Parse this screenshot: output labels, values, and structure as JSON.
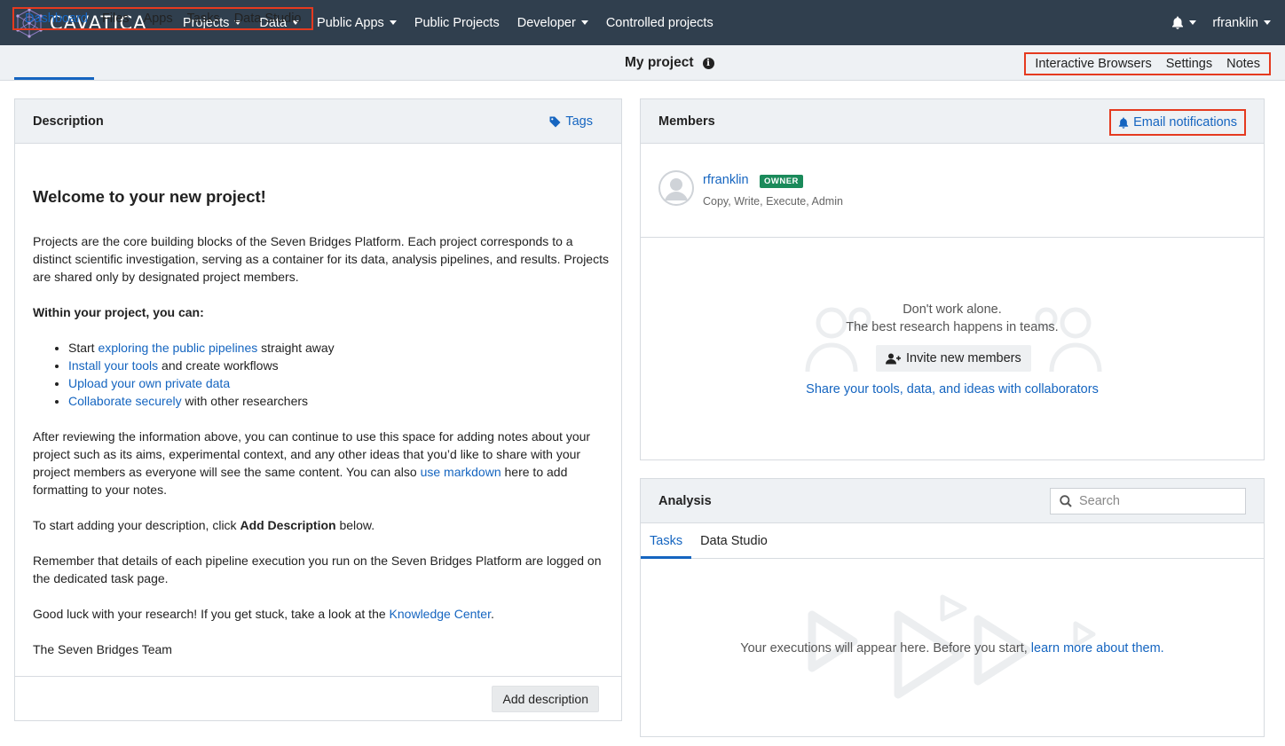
{
  "brand": {
    "name": "CAVATICA"
  },
  "topnav": {
    "items": [
      {
        "label": "Projects",
        "dropdown": true
      },
      {
        "label": "Data",
        "dropdown": true
      },
      {
        "label": "Public Apps",
        "dropdown": true
      },
      {
        "label": "Public Projects",
        "dropdown": false
      },
      {
        "label": "Developer",
        "dropdown": true
      },
      {
        "label": "Controlled projects",
        "dropdown": false
      }
    ],
    "user": "rfranklin"
  },
  "subnav": {
    "left_tabs": [
      "Dashboard",
      "Files",
      "Apps",
      "Tasks",
      "Data Studio"
    ],
    "active": "Dashboard",
    "project_title": "My project",
    "right_tabs": [
      "Interactive Browsers",
      "Settings",
      "Notes"
    ]
  },
  "description": {
    "title": "Description",
    "tags_label": "Tags",
    "heading": "Welcome to your new project!",
    "p1": "Projects are the core building blocks of the Seven Bridges Platform. Each project corresponds to a distinct scientific investigation, serving as a container for its data, analysis pipelines, and results. Projects are shared only by designated project members.",
    "within_heading": "Within your project, you can:",
    "bullets": [
      {
        "pre": "Start ",
        "link": "exploring the public pipelines",
        "post": " straight away"
      },
      {
        "pre": "",
        "link": "Install your tools",
        "post": " and create workflows"
      },
      {
        "pre": "",
        "link": "Upload your own private data",
        "post": ""
      },
      {
        "pre": "",
        "link": "Collaborate securely",
        "post": " with other researchers"
      }
    ],
    "p2_pre": "After reviewing the information above, you can continue to use this space for adding notes about your project such as its aims, experimental context, and any other ideas that you’d like to share with your project members as everyone will see the same content. You can also ",
    "p2_link": "use markdown",
    "p2_post": " here to add formatting to your notes.",
    "p3_pre": "To start adding your description, click ",
    "p3_bold": "Add Description",
    "p3_post": " below.",
    "p4": "Remember that details of each pipeline execution you run on the Seven Bridges Platform are logged on the dedicated task page.",
    "p5_pre": "Good luck with your research! If you get stuck, take a look at the ",
    "p5_link": "Knowledge Center",
    "p5_post": ".",
    "signoff": "The Seven Bridges Team",
    "add_button": "Add description"
  },
  "members": {
    "title": "Members",
    "email_notifications": "Email notifications",
    "list": [
      {
        "name": "rfranklin",
        "badge": "OWNER",
        "permissions": "Copy, Write, Execute, Admin"
      }
    ],
    "empty_line1": "Don't work alone.",
    "empty_line2": "The best research happens in teams.",
    "invite_button": "Invite new members",
    "share_link": "Share your tools, data, and ideas with collaborators"
  },
  "analysis": {
    "title": "Analysis",
    "search_placeholder": "Search",
    "tabs": [
      "Tasks",
      "Data Studio"
    ],
    "active_tab": "Tasks",
    "empty_pre": "Your executions will appear here. Before you start, ",
    "empty_link": "learn more about them."
  },
  "colors": {
    "topbar": "#303f4e",
    "link": "#1565c0",
    "highlight": "#e53a1f",
    "owner_badge": "#1a8a5a"
  }
}
